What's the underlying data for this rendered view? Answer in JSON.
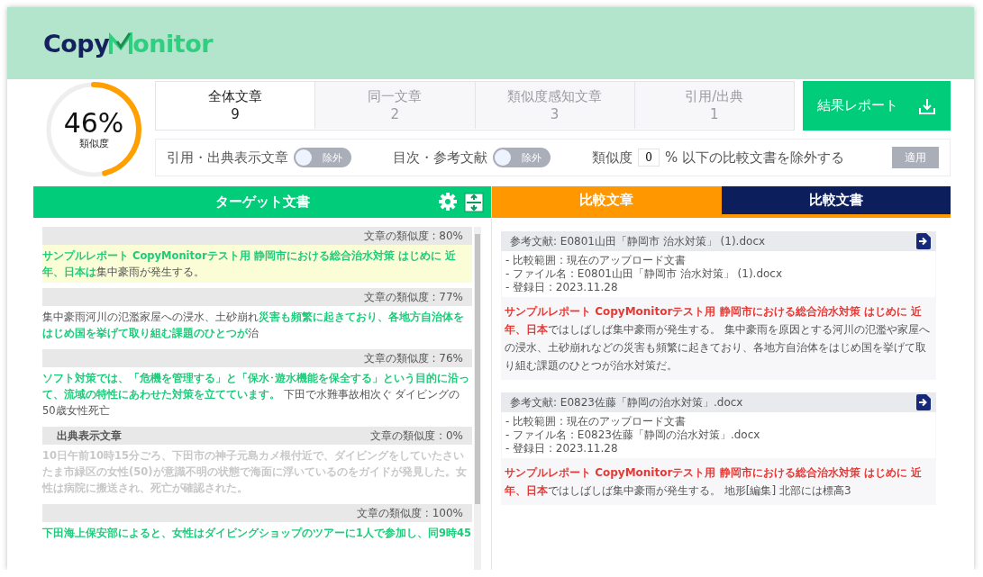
{
  "logo": {
    "part1": "Copy",
    "part2": "onitor"
  },
  "similarity": {
    "value": "46%",
    "label": "類似度",
    "level": 0.46
  },
  "tabs": [
    {
      "label": "全体文章",
      "count": "9",
      "selected": true
    },
    {
      "label": "同一文章",
      "count": "2",
      "selected": false
    },
    {
      "label": "類似度感知文章",
      "count": "3",
      "selected": false
    },
    {
      "label": "引用/出典",
      "count": "1",
      "selected": false
    }
  ],
  "report_button": "結果レポート",
  "filters": {
    "citation_label": "引用・出典表示文章",
    "citation_toggle": {
      "text": "除外",
      "on": false
    },
    "toc_label": "目次・参考文献",
    "toc_toggle": {
      "text": "除外",
      "on": false
    },
    "threshold_prefix": "類似度",
    "threshold_value": "0",
    "threshold_suffix": "% 以下の比較文書を除外する",
    "apply_button": {
      "label": "適用",
      "disabled": true
    }
  },
  "target": {
    "title": "ターゲット文書",
    "paragraphs": [
      {
        "kind": "match",
        "selected": true,
        "similarity": "文章の類似度 : 80%",
        "segments": [
          {
            "text": "サンプルレポート CopyMonitorテスト用 静岡市における総合治水対策 はじめに 近年、日本は",
            "matched": true
          },
          {
            "text": "集中豪雨が発生する。",
            "matched": false
          }
        ]
      },
      {
        "kind": "match",
        "selected": false,
        "similarity": "文章の類似度 : 77%",
        "segments": [
          {
            "text": "集中豪雨河川の氾濫家屋への浸水、土砂崩れ",
            "matched": false
          },
          {
            "text": "災害も頻繁に起きており、各地方自治体をはじめ国を挙げて取り組む課題のひとつが",
            "matched": true
          },
          {
            "text": "治",
            "matched": false
          }
        ]
      },
      {
        "kind": "match",
        "selected": false,
        "similarity": "文章の類似度 : 76%",
        "segments": [
          {
            "text": "ソフト対策では、「危機を管理する」と「保水･遊水機能を保全する」という目的に沿って、流域の特性にあわせた対策を立てています。",
            "matched": true
          },
          {
            "text": " 下田で水難事故相次ぐ ダイビングの50歳女性死亡",
            "matched": false
          }
        ]
      },
      {
        "kind": "citation",
        "selected": false,
        "label": "出典表示文章",
        "similarity": "文章の類似度 : 0%",
        "segments": [
          {
            "text": "10日午前10時15分ごろ、下田市の神子元島カメ根付近で、ダイビングをしていたさいたま市緑区の女性(50)が意識不明の状態で海面に浮いているのをガイドが発見した。女性は病院に搬送され、死亡が確認された。",
            "matched": false
          }
        ]
      },
      {
        "kind": "match",
        "selected": false,
        "similarity": "文章の類似度 : 100%",
        "segments": [
          {
            "text": "下田海上保安部によると、女性はダイビングショップのツアーに1人で参加し、同9時45",
            "matched": true
          }
        ]
      }
    ]
  },
  "compare_tabs": [
    {
      "label": "比較文章",
      "selected": true
    },
    {
      "label": "比較文書",
      "selected": false
    }
  ],
  "sources": [
    {
      "title": "参考文献: E0801山田「静岡市 治水対策」 (1).docx",
      "details": [
        "- 比較範囲 : 現在のアップロード文書",
        "- ファイル名 : E0801山田「静岡市 治水対策」 (1).docx",
        "- 登録日 : 2023.11.28"
      ],
      "segments": [
        {
          "text": "サンプルレポート CopyMonitorテスト用 静岡市における総合治水対策 はじめに 近年、日本",
          "matched": true
        },
        {
          "text": "ではしばしば集中豪雨が発生する。 集中豪雨を原因とする河川の氾濫や家屋への浸水、土砂崩れなどの災害も頻繁に起きており、各地方自治体をはじめ国を挙げて取り組む課題のひとつが治水対策だ。",
          "matched": false
        }
      ]
    },
    {
      "title": "参考文献: E0823佐藤「静岡の治水対策」.docx",
      "details": [
        "- 比較範囲 : 現在のアップロード文書",
        "- ファイル名 : E0823佐藤「静岡の治水対策」.docx",
        "- 登録日 : 2023.11.28"
      ],
      "segments": [
        {
          "text": "サンプルレポート CopyMonitorテスト用 静岡市における総合治水対策 はじめに 近年、日本",
          "matched": true
        },
        {
          "text": "ではしばしば集中豪雨が発生する。 地形[編集] 北部には標高3",
          "matched": false
        }
      ]
    }
  ]
}
